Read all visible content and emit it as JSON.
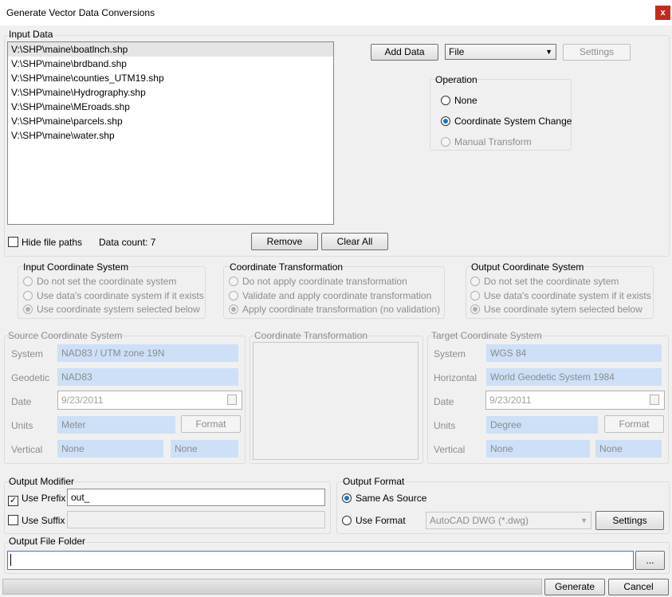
{
  "window": {
    "title": "Generate Vector Data Conversions",
    "close_glyph": "x"
  },
  "input_data": {
    "label": "Input Data",
    "files": [
      "V:\\SHP\\maine\\boatlnch.shp",
      "V:\\SHP\\maine\\brdband.shp",
      "V:\\SHP\\maine\\counties_UTM19.shp",
      "V:\\SHP\\maine\\Hydrography.shp",
      "V:\\SHP\\maine\\MEroads.shp",
      "V:\\SHP\\maine\\parcels.shp",
      "V:\\SHP\\maine\\water.shp"
    ],
    "hide_paths_label": "Hide file paths",
    "data_count": "Data count: 7",
    "remove_label": "Remove",
    "clear_all_label": "Clear All",
    "add_data_label": "Add Data",
    "source_select": "File",
    "settings_label": "Settings"
  },
  "operation": {
    "label": "Operation",
    "options": [
      "None",
      "Coordinate System Change",
      "Manual Transform"
    ]
  },
  "input_cs": {
    "label": "Input Coordinate System",
    "options": [
      "Do not set the coordinate system",
      "Use data's coordinate system if it exists",
      "Use coordinate system selected below"
    ]
  },
  "coord_trans": {
    "label": "Coordinate Transformation",
    "options": [
      "Do not apply coordinate transformation",
      "Validate and apply coordinate transformation",
      "Apply coordinate transformation (no validation)"
    ]
  },
  "output_cs": {
    "label": "Output Coordinate System",
    "options": [
      "Do not set the coordinate sytem",
      "Use data's coordinate system if it exists",
      "Use coordinate sytem selected below"
    ]
  },
  "source_cs": {
    "label": "Source Coordinate System",
    "system_label": "System",
    "system": "NAD83 / UTM zone 19N",
    "geodetic_label": "Geodetic",
    "geodetic": "NAD83",
    "date_label": "Date",
    "date": "9/23/2011",
    "units_label": "Units",
    "units": "Meter",
    "format_label": "Format",
    "vertical_label": "Vertical",
    "vertical": "None",
    "vertical2": "None"
  },
  "transform_panel": {
    "label": "Coordinate Transformation"
  },
  "target_cs": {
    "label": "Target Coordinate System",
    "system_label": "System",
    "system": "WGS 84",
    "horizontal_label": "Horizontal",
    "horizontal": "World Geodetic System 1984",
    "date_label": "Date",
    "date": "9/23/2011",
    "units_label": "Units",
    "units": "Degree",
    "format_label": "Format",
    "vertical_label": "Vertical",
    "vertical": "None",
    "vertical2": "None"
  },
  "output_modifier": {
    "label": "Output Modifier",
    "use_prefix_label": "Use Prefix",
    "prefix_value": "out_",
    "use_suffix_label": "Use Suffix",
    "suffix_value": ""
  },
  "output_format": {
    "label": "Output Format",
    "same_as_source_label": "Same As Source",
    "use_format_label": "Use Format",
    "format_value": "AutoCAD DWG (*.dwg)",
    "settings_label": "Settings"
  },
  "output_folder": {
    "label": "Output File Folder",
    "value": "",
    "browse_label": "..."
  },
  "footer": {
    "generate_label": "Generate",
    "cancel_label": "Cancel"
  }
}
